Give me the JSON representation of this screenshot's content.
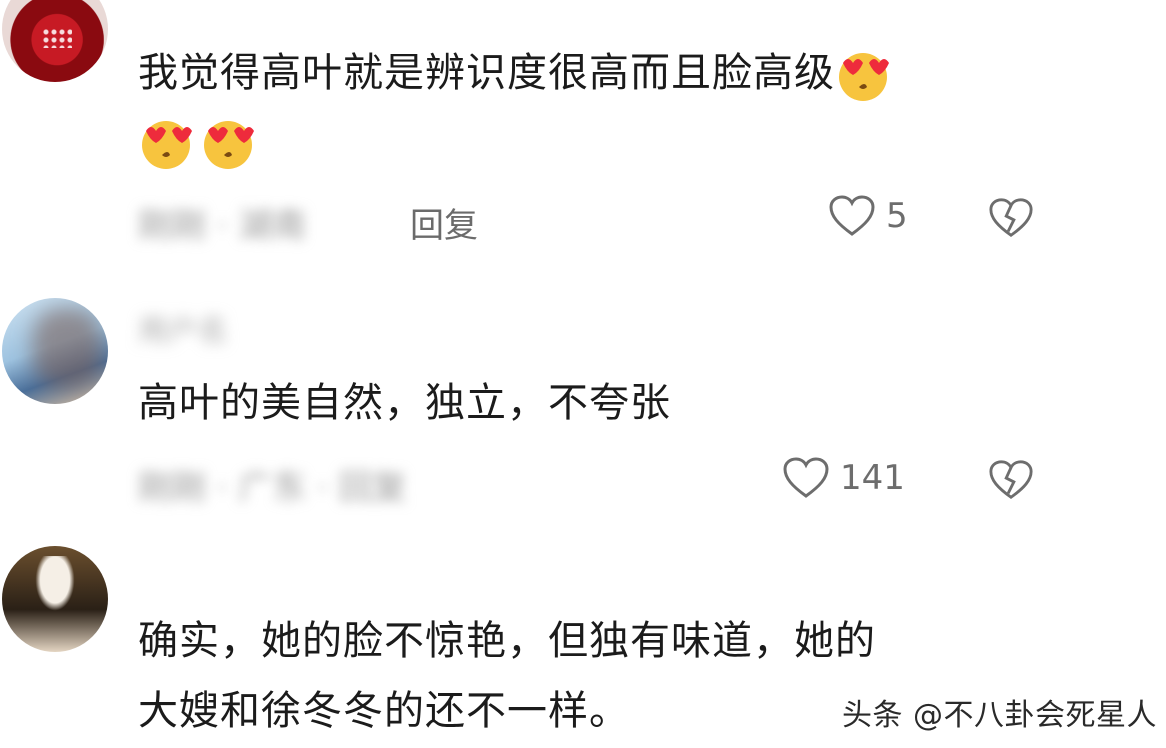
{
  "comments": [
    {
      "text": "我觉得高叶就是辨识度很高而且脸高级",
      "emoji_count_inline": 1,
      "emoji_count_second_line": 2,
      "emoji": "smiling-face-with-heart-eyes",
      "meta_blurred": "刚刚 · 湖南",
      "reply_label": "回复",
      "likes": "5"
    },
    {
      "username_blurred": "用户名",
      "text": "高叶的美自然，独立，不夸张",
      "meta_blurred": "刚刚 · 广东 · 回复",
      "likes": "141"
    },
    {
      "text_line1": "确实，她的脸不惊艳，但独有味道，她的",
      "text_line2": "大嫂和徐冬冬的还不一样。"
    }
  ],
  "watermark": "头条 @不八卦会死星人",
  "colors": {
    "text": "#1b1b1b",
    "meta": "#7a7a7a",
    "icon": "#6d6d6d"
  }
}
